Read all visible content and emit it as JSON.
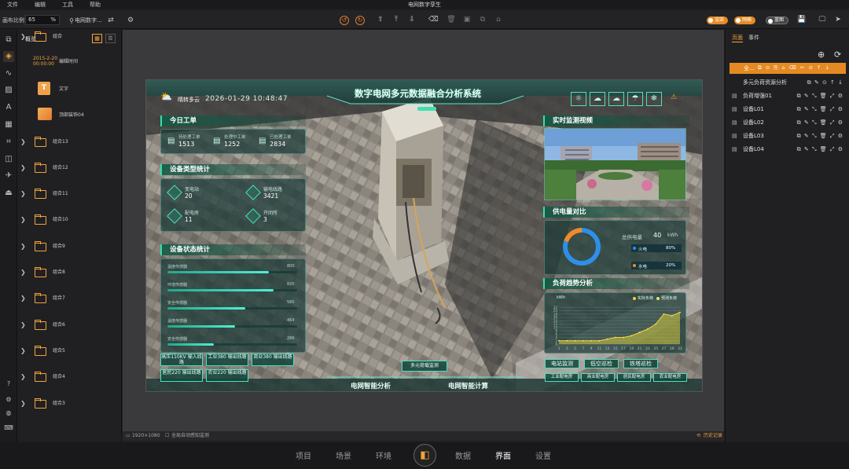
{
  "menu": [
    "文件",
    "编辑",
    "工具",
    "帮助"
  ],
  "app_title": "电网数字孪生",
  "toolbar": {
    "scale_label": "画布比例",
    "scale_value": "65",
    "scale_unit": "%",
    "project_name": "电网数字...",
    "toggle_labels": [
      "渲染",
      "网格",
      "蓝图"
    ]
  },
  "outline": {
    "title": "概览",
    "items": [
      {
        "type": "folder",
        "label": "组合"
      },
      {
        "type": "datetime",
        "label": "编辑时间",
        "date": "2015-2-20",
        "time": "00:00:00"
      },
      {
        "type": "text",
        "label": "文字"
      },
      {
        "type": "image",
        "label": "顶部装饰04"
      },
      {
        "type": "folder",
        "label": "组合13"
      },
      {
        "type": "folder",
        "label": "组合12"
      },
      {
        "type": "folder",
        "label": "组合11"
      },
      {
        "type": "folder",
        "label": "组合10"
      },
      {
        "type": "folder",
        "label": "组合9"
      },
      {
        "type": "folder",
        "label": "组合8"
      },
      {
        "type": "folder",
        "label": "组合7"
      },
      {
        "type": "folder",
        "label": "组合6"
      },
      {
        "type": "folder",
        "label": "组合5"
      },
      {
        "type": "folder",
        "label": "组合4"
      },
      {
        "type": "folder",
        "label": "组合3"
      }
    ]
  },
  "status": {
    "resolution": "1920×1080",
    "note": "全局自动感知监测",
    "history": "历史记录"
  },
  "bottom_nav": [
    "项目",
    "场景",
    "环境",
    "数据",
    "界面",
    "设置"
  ],
  "bottom_active": "界面",
  "right_panel": {
    "tabs": [
      "页面",
      "事件"
    ],
    "selected": "全...",
    "rows": [
      "多元负荷资源分析",
      "负荷增强01",
      "设备L01",
      "设备L02",
      "设备L03",
      "设备L04"
    ]
  },
  "dashboard": {
    "title": "数字电网多元数据融合分析系统",
    "weather": "晴转多云",
    "datetime": "2026-01-29 10:48:47",
    "today_orders": {
      "title": "今日工单",
      "items": [
        {
          "label": "待处理工单",
          "value": "1513"
        },
        {
          "label": "处理中工单",
          "value": "1252"
        },
        {
          "label": "已处理工单",
          "value": "2834"
        }
      ]
    },
    "device_types": {
      "title": "设备类型统计",
      "items": [
        {
          "label": "变电站",
          "value": "20"
        },
        {
          "label": "输电线路",
          "value": "3421"
        },
        {
          "label": "配电房",
          "value": "11"
        },
        {
          "label": "开闭所",
          "value": "3"
        }
      ]
    },
    "device_status": {
      "title": "设备状态统计",
      "rows": [
        {
          "label": "温度传感器",
          "value": "800",
          "pct": 0.78
        },
        {
          "label": "环境传感器",
          "value": "820",
          "pct": 0.82
        },
        {
          "label": "安全传感器",
          "value": "580",
          "pct": 0.6
        },
        {
          "label": "温度传感器",
          "value": "464",
          "pct": 0.52
        },
        {
          "label": "安全传感器",
          "value": "286",
          "pct": 0.36
        }
      ]
    },
    "tags_left": [
      "高压110KV 输入线路",
      "工业380 输出线路",
      "商业380 输出线路",
      "居民220 输出线路",
      "农业220 输出线路"
    ],
    "tag_center": "多元荷载监测",
    "monitor_title": "实时监测视频",
    "supply": {
      "title": "供电量对比",
      "total_label": "总供电量",
      "total_value": "40",
      "unit": "kWh",
      "items": [
        {
          "label": "火电",
          "pct": "80%"
        },
        {
          "label": "水电",
          "pct": "20%"
        }
      ]
    },
    "load_trend": {
      "title": "负荷趋势分析",
      "unit": "kWh",
      "legend": [
        "实际负荷",
        "预测负荷"
      ]
    },
    "right_tags": [
      "电站监测",
      "低空巡检",
      "铁塔巡检"
    ],
    "right_tags2": [
      "工业配电房",
      "商业配电房",
      "居民配电房",
      "农业配电房"
    ],
    "bottom_left": "电网智能分析",
    "bottom_right": "电网智能计算",
    "weather_icons": [
      "晴",
      "多云",
      "阴",
      "雨",
      "雪",
      "",
      "温湿报警"
    ]
  },
  "chart_data": {
    "type": "area",
    "x": [
      1,
      3,
      5,
      7,
      9,
      11,
      13,
      15,
      17,
      19,
      21,
      23,
      25,
      27,
      29,
      31
    ],
    "y_ticks": [
      0,
      2,
      4,
      6,
      8,
      10,
      12,
      14,
      16,
      18,
      20,
      22
    ],
    "series": [
      {
        "name": "实际负荷",
        "values": [
          2,
          2,
          2,
          2,
          2,
          2,
          3,
          4,
          4,
          5,
          7,
          9,
          12,
          18,
          17,
          19
        ]
      }
    ],
    "ylim": [
      0,
      24
    ]
  },
  "colors": {
    "accent": "#f2a33a",
    "teal": "#36e0a8",
    "orange_btn": "#e58a22",
    "blue_ring": "#2f8fe6"
  }
}
